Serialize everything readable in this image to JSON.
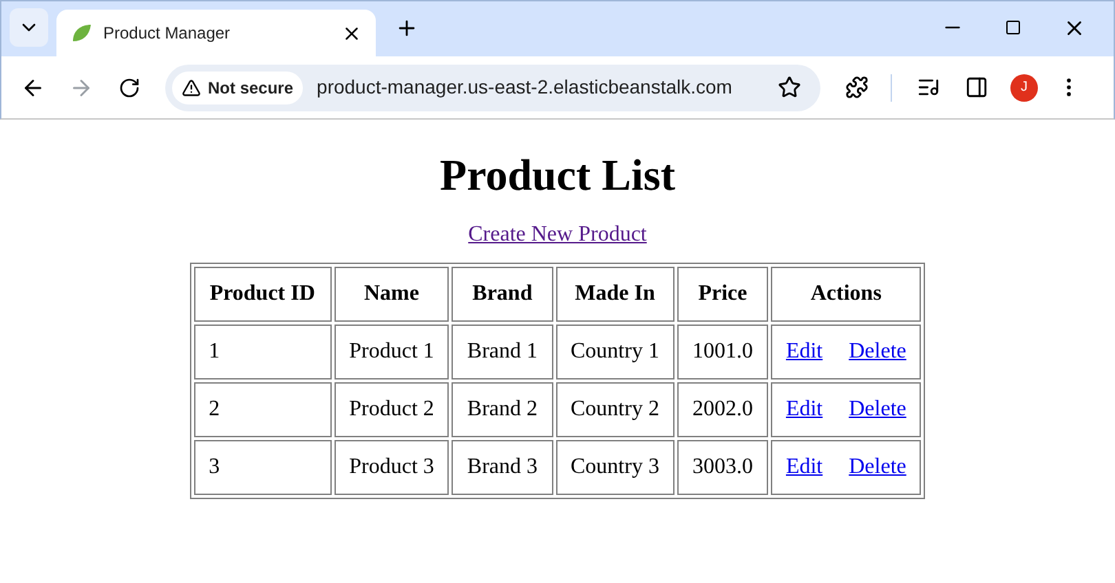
{
  "browser": {
    "tab": {
      "title": "Product Manager",
      "selected": true
    },
    "security_label": "Not secure",
    "url": "product-manager.us-east-2.elasticbeanstalk.com",
    "avatar_letter": "J"
  },
  "page": {
    "title": "Product List",
    "create_link": "Create New Product",
    "table": {
      "columns": [
        "Product ID",
        "Name",
        "Brand",
        "Made In",
        "Price",
        "Actions"
      ],
      "rows": [
        {
          "id": "1",
          "name": "Product 1",
          "brand": "Brand 1",
          "made_in": "Country 1",
          "price": "1001.0",
          "actions": [
            "Edit",
            "Delete"
          ]
        },
        {
          "id": "2",
          "name": "Product 2",
          "brand": "Brand 2",
          "made_in": "Country 2",
          "price": "2002.0",
          "actions": [
            "Edit",
            "Delete"
          ]
        },
        {
          "id": "3",
          "name": "Product 3",
          "brand": "Brand 3",
          "made_in": "Country 3",
          "price": "3003.0",
          "actions": [
            "Edit",
            "Delete"
          ]
        }
      ]
    }
  }
}
